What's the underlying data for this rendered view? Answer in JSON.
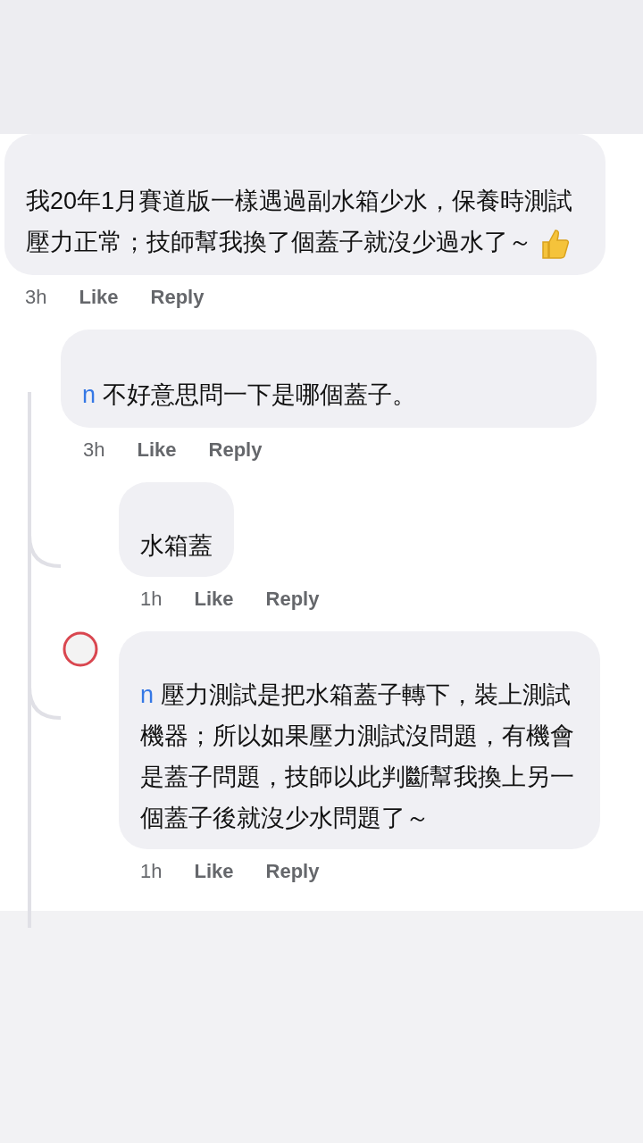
{
  "comments": [
    {
      "text": "我20年1月賽道版一樣遇過副水箱少水，保養時測試壓力正常；技師幫我換了個蓋子就沒少過水了～",
      "thumbs_up": true,
      "time": "3h",
      "actions": [
        "Like",
        "Reply"
      ],
      "replies": [
        {
          "mention": "n",
          "text": "不好意思問一下是哪個蓋子。",
          "time": "3h",
          "actions": [
            "Like",
            "Reply"
          ],
          "replies": [
            {
              "text": "水箱蓋",
              "time": "1h",
              "actions": [
                "Like",
                "Reply"
              ]
            },
            {
              "mention": "n",
              "text": "壓力測試是把水箱蓋子轉下，裝上測試機器；所以如果壓力測試沒問題，有機會是蓋子問題，技師以此判斷幫我換上另一個蓋子後就沒少水問題了～",
              "time": "1h",
              "actions": [
                "Like",
                "Reply"
              ]
            }
          ]
        }
      ]
    }
  ]
}
